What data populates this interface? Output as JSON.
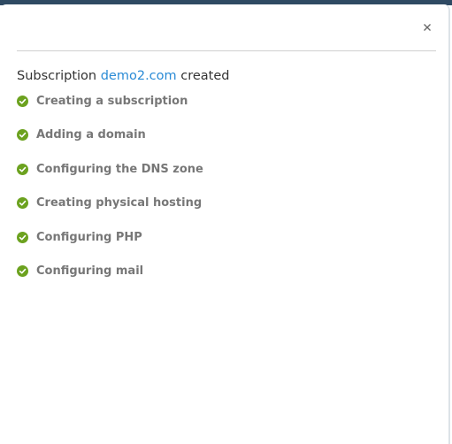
{
  "dialog": {
    "close_icon": "close-icon",
    "title_prefix": "Subscription",
    "domain_link": "demo2.com",
    "title_suffix": "created",
    "status_color": "#6ca21f",
    "link_color": "#2a8bd6"
  },
  "steps": [
    {
      "label": "Creating a subscription",
      "status": "done",
      "icon": "check-circle-icon"
    },
    {
      "label": "Adding a domain",
      "status": "done",
      "icon": "check-circle-icon"
    },
    {
      "label": "Configuring the DNS zone",
      "status": "done",
      "icon": "check-circle-icon"
    },
    {
      "label": "Creating physical hosting",
      "status": "done",
      "icon": "check-circle-icon"
    },
    {
      "label": "Configuring PHP",
      "status": "done",
      "icon": "check-circle-icon"
    },
    {
      "label": "Configuring mail",
      "status": "done",
      "icon": "check-circle-icon"
    }
  ]
}
